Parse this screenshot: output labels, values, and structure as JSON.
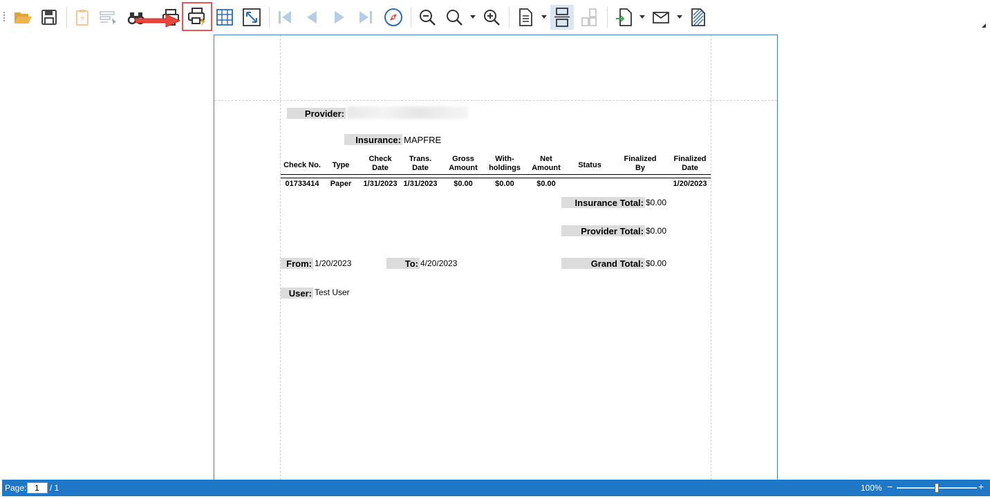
{
  "toolbar": {
    "buttons": [
      {
        "name": "open-button",
        "icon": "folder-open-icon"
      },
      {
        "name": "save-button",
        "icon": "save-icon"
      },
      {
        "name": "parameters-button",
        "icon": "clipboard-icon"
      },
      {
        "name": "editing-fields-button",
        "icon": "edit-fields-icon"
      },
      {
        "name": "find-button",
        "icon": "binoculars-icon"
      },
      {
        "name": "print-button",
        "icon": "printer-icon"
      },
      {
        "name": "quick-print-button",
        "icon": "quick-printer-icon"
      },
      {
        "name": "page-setup-button",
        "icon": "grid-icon"
      },
      {
        "name": "scale-button",
        "icon": "expand-icon"
      },
      {
        "name": "first-page-button",
        "icon": "first-page-icon"
      },
      {
        "name": "previous-page-button",
        "icon": "previous-page-icon"
      },
      {
        "name": "next-page-button",
        "icon": "next-page-icon"
      },
      {
        "name": "last-page-button",
        "icon": "last-page-icon"
      },
      {
        "name": "navigation-button",
        "icon": "compass-icon"
      },
      {
        "name": "zoom-out-button",
        "icon": "zoom-out-icon"
      },
      {
        "name": "zoom-button",
        "icon": "zoom-icon"
      },
      {
        "name": "zoom-in-button",
        "icon": "zoom-in-icon"
      },
      {
        "name": "single-page-button",
        "icon": "single-page-icon"
      },
      {
        "name": "continuous-view-button",
        "icon": "continuous-view-icon"
      },
      {
        "name": "multiple-pages-button",
        "icon": "multiple-pages-icon"
      },
      {
        "name": "export-button",
        "icon": "export-document-icon"
      },
      {
        "name": "email-button",
        "icon": "envelope-icon"
      },
      {
        "name": "watermark-button",
        "icon": "watermark-icon"
      }
    ],
    "accent": "#1e77c7",
    "highlight_color": "#e05858"
  },
  "report": {
    "provider_label": "Provider:",
    "insurance_label": "Insurance:",
    "insurance_value": "MAPFRE",
    "columns": [
      {
        "line1": "Check No.",
        "line2": ""
      },
      {
        "line1": "Type",
        "line2": ""
      },
      {
        "line1": "Check",
        "line2": "Date"
      },
      {
        "line1": "Trans.",
        "line2": "Date"
      },
      {
        "line1": "Gross",
        "line2": "Amount"
      },
      {
        "line1": "With-",
        "line2": "holdings"
      },
      {
        "line1": "Net",
        "line2": "Amount"
      },
      {
        "line1": "Status",
        "line2": ""
      },
      {
        "line1": "Finalized",
        "line2": "By"
      },
      {
        "line1": "Finalized",
        "line2": "Date"
      }
    ],
    "rows": [
      [
        "01733414",
        "Paper",
        "1/31/2023",
        "1/31/2023",
        "$0.00",
        "$0.00",
        "$0.00",
        "",
        "",
        "1/20/2023"
      ]
    ],
    "insurance_total_label": "Insurance Total:",
    "insurance_total_value": "$0.00",
    "provider_total_label": "Provider Total:",
    "provider_total_value": "$0.00",
    "from_label": "From:",
    "from_value": "1/20/2023",
    "to_label": "To:",
    "to_value": "4/20/2023",
    "grand_total_label": "Grand Total:",
    "grand_total_value": "$0.00",
    "user_label": "User:",
    "user_value": "Test User"
  },
  "statusbar": {
    "page_label": "Page:",
    "page_value": "1",
    "page_total": "/ 1",
    "zoom_text": "100%",
    "zoom_minus": "−",
    "zoom_plus": "+"
  }
}
